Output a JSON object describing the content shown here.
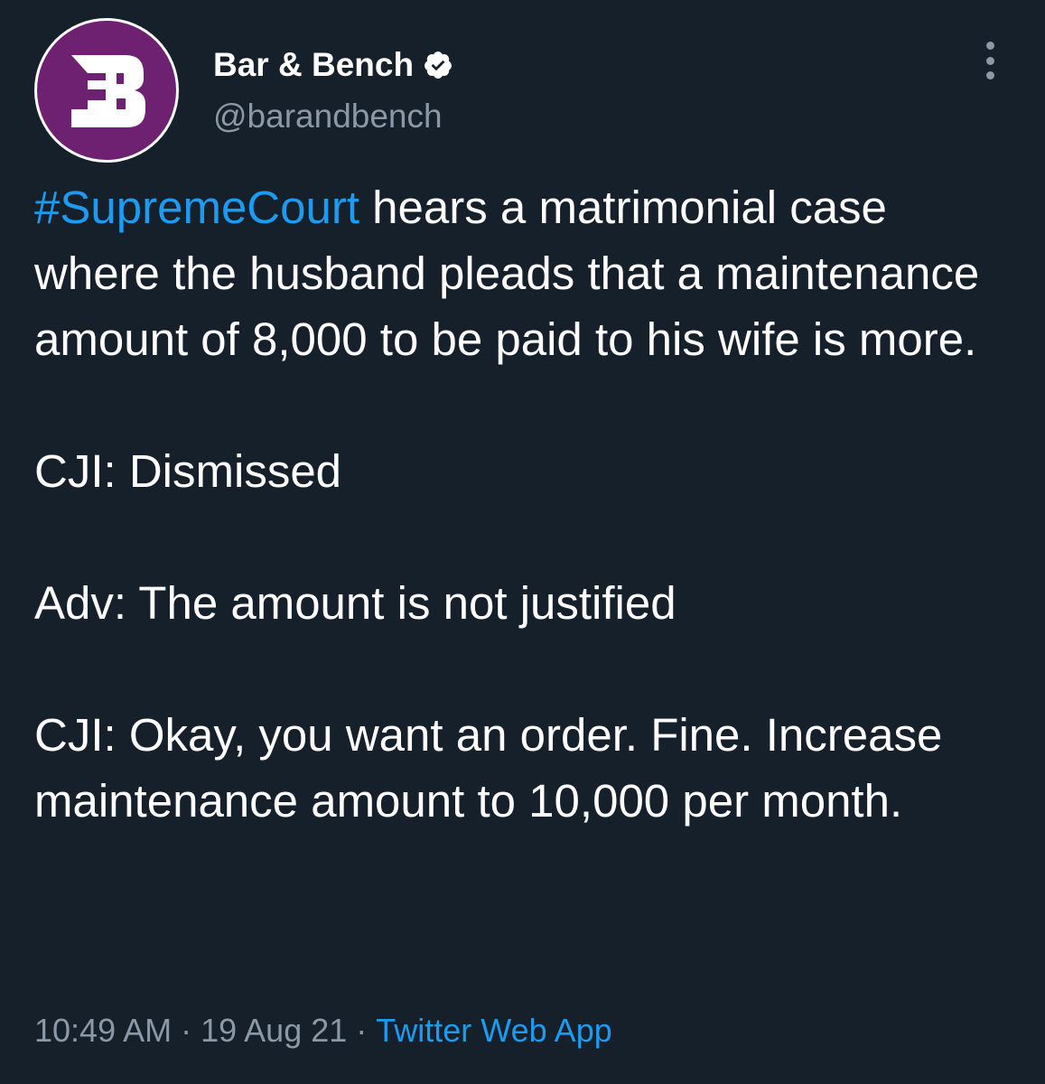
{
  "author": {
    "avatar_letter": "B",
    "display_name": "Bar & Bench",
    "handle": "@barandbench",
    "verified_icon": "verified-badge-icon",
    "avatar_color": "#6d2170"
  },
  "tweet": {
    "hashtag": "#SupremeCourt",
    "para1_rest": " hears a matrimonial case where the husband pleads that a maintenance amount of 8,000 to be paid to his wife is more.",
    "para2": "CJI: Dismissed",
    "para3": "Adv: The amount is not justified",
    "para4": "CJI: Okay, you want an order. Fine. Increase maintenance amount to 10,000 per month."
  },
  "meta": {
    "time": "10:49 AM",
    "date": "19 Aug 21",
    "separator": "·",
    "source": "Twitter Web App"
  },
  "colors": {
    "background": "#15202b",
    "link": "#1d9bf0",
    "secondary_text": "#8b98a5"
  }
}
